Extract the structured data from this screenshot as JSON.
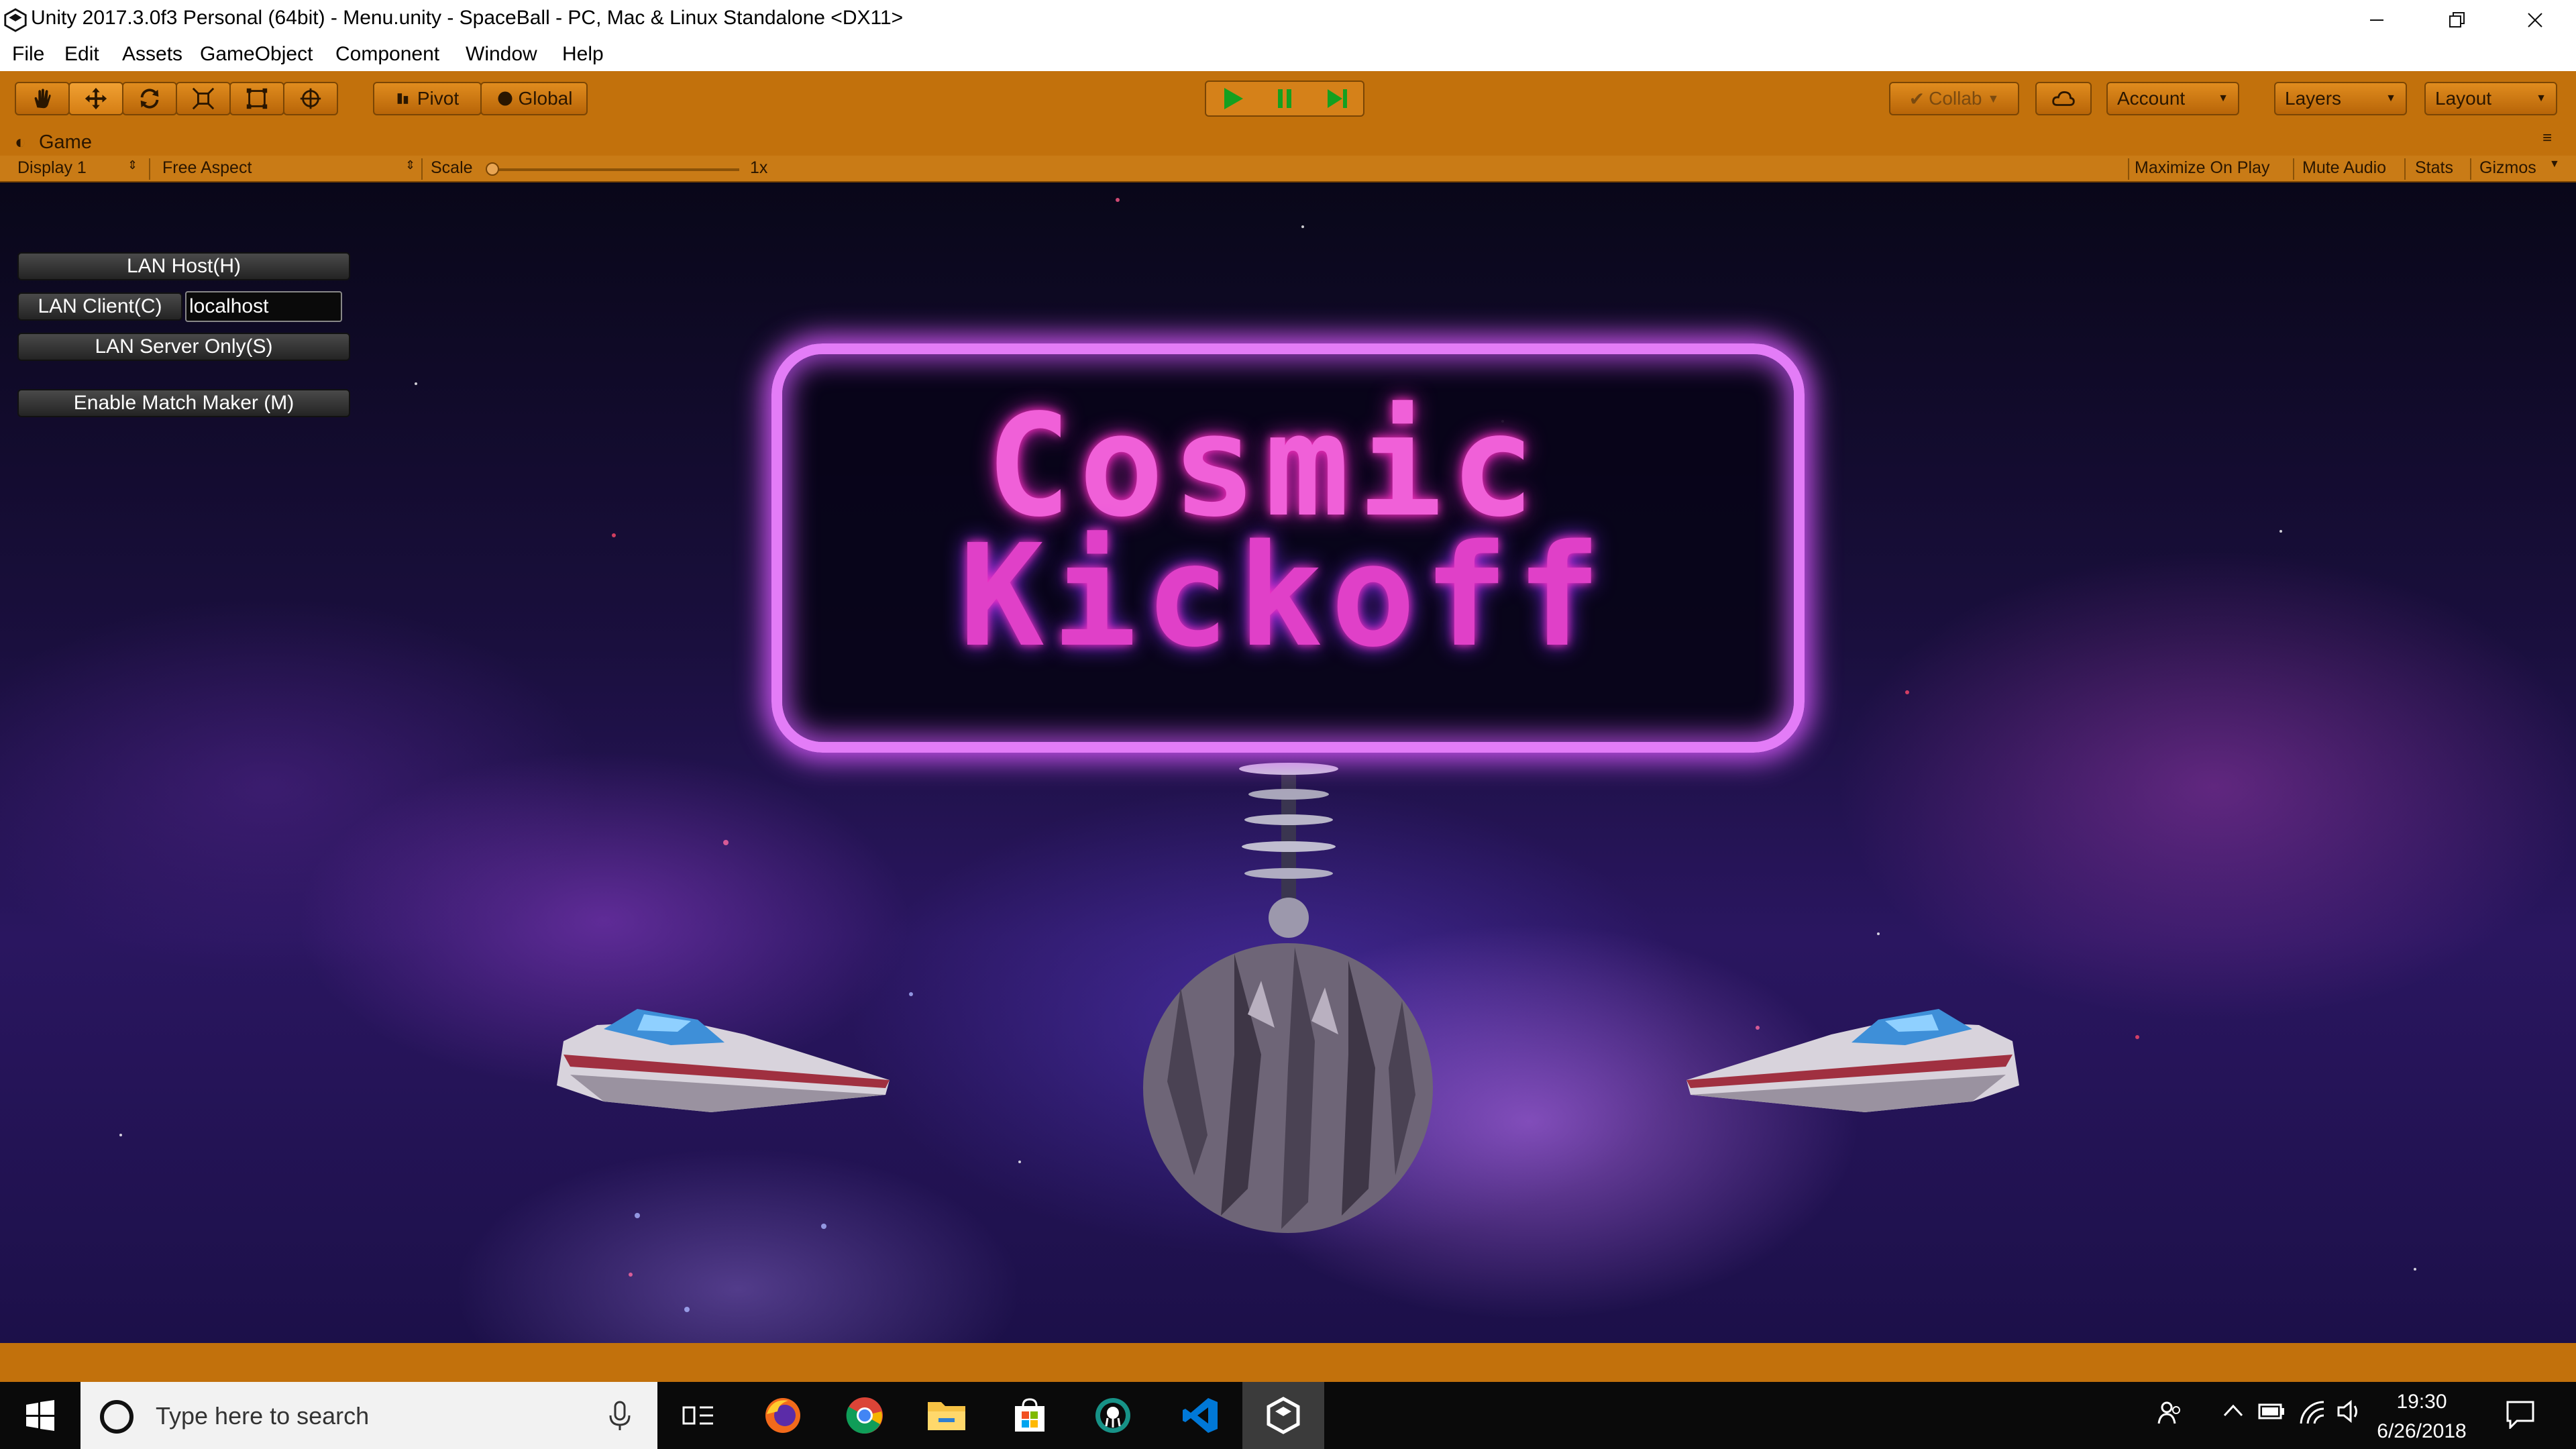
{
  "window": {
    "title": "Unity 2017.3.0f3 Personal (64bit) - Menu.unity - SpaceBall - PC, Mac & Linux Standalone <DX11>",
    "controls": [
      "minimize",
      "restore",
      "close"
    ]
  },
  "menu": {
    "items": [
      "File",
      "Edit",
      "Assets",
      "GameObject",
      "Component",
      "Window",
      "Help"
    ]
  },
  "toolbar": {
    "tools": [
      "hand-tool",
      "move-tool",
      "rotate-tool",
      "scale-tool",
      "rect-tool",
      "transform-tool"
    ],
    "pivot_label": "Pivot",
    "global_label": "Global",
    "collab_label": "Collab",
    "account_label": "Account",
    "layers_label": "Layers",
    "layout_label": "Layout",
    "play_state": "playing"
  },
  "game_tab": {
    "title": "Game",
    "display": "Display 1",
    "aspect": "Free Aspect",
    "scale_label": "Scale",
    "scale_value": "1x",
    "maximize_label": "Maximize On Play",
    "mute_label": "Mute Audio",
    "stats_label": "Stats",
    "gizmos_label": "Gizmos"
  },
  "game": {
    "lan_host": "LAN Host(H)",
    "lan_client": "LAN Client(C)",
    "client_address": "localhost",
    "lan_server": "LAN Server Only(S)",
    "match_maker": "Enable Match Maker (M)",
    "logo_line1": "Cosmic",
    "logo_line2": "Kickoff"
  },
  "taskbar": {
    "search_placeholder": "Type here to search",
    "apps": [
      "firefox-icon",
      "chrome-icon",
      "file-explorer-icon",
      "store-icon",
      "gitkraken-icon",
      "vscode-icon",
      "unity-icon"
    ],
    "time": "19:30",
    "date": "6/26/2018"
  },
  "colors": {
    "toolbar": "#c2710c",
    "logo_frame": "#e37cf7",
    "logo_text": "#f060d8"
  }
}
